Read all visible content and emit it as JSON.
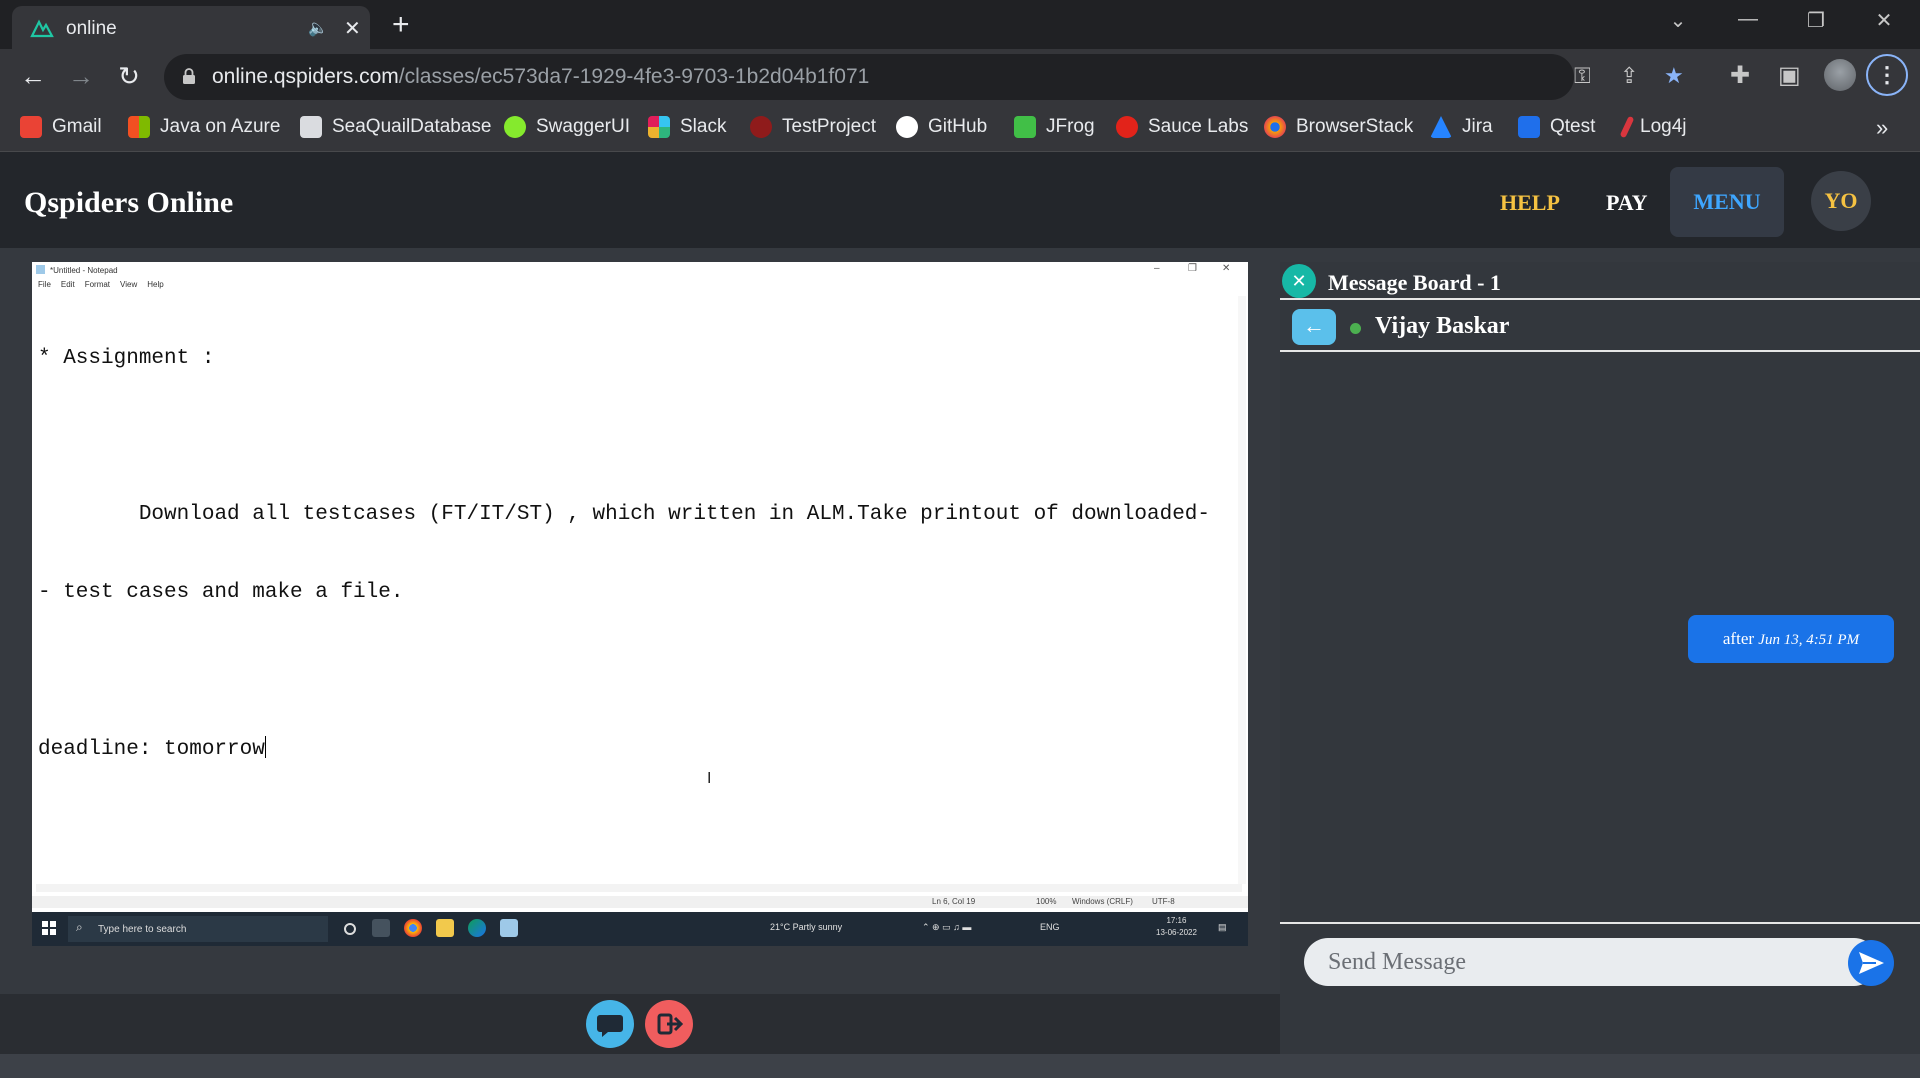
{
  "browser": {
    "tab_title": "online",
    "url_host": "online.qspiders.com",
    "url_path": "/classes/ec573da7-1929-4fe3-9703-1b2d04b1f071",
    "bookmarks": [
      {
        "label": "Gmail",
        "icon": "gmail-icon",
        "color": "#ea4335"
      },
      {
        "label": "Java on Azure",
        "icon": "microsoft-icon",
        "color": "#f25022"
      },
      {
        "label": "SeaQuailDatabase",
        "icon": "document-icon",
        "color": "#dadce0"
      },
      {
        "label": "SwaggerUI",
        "icon": "swagger-icon",
        "color": "#85ea2d"
      },
      {
        "label": "Slack",
        "icon": "slack-icon",
        "color": "#e01e5a"
      },
      {
        "label": "TestProject",
        "icon": "testproject-icon",
        "color": "#8f1b1b"
      },
      {
        "label": "GitHub",
        "icon": "github-icon",
        "color": "#ffffff"
      },
      {
        "label": "JFrog",
        "icon": "jfrog-icon",
        "color": "#41bf47"
      },
      {
        "label": "Sauce Labs",
        "icon": "saucelabs-icon",
        "color": "#e2231a"
      },
      {
        "label": "BrowserStack",
        "icon": "browserstack-icon",
        "color": "#f59e0b"
      },
      {
        "label": "Jira",
        "icon": "jira-icon",
        "color": "#2684ff"
      },
      {
        "label": "Qtest",
        "icon": "qtest-icon",
        "color": "#1f6feb"
      },
      {
        "label": "Log4j",
        "icon": "log4j-icon",
        "color": "#d9363e"
      }
    ]
  },
  "app": {
    "brand": "Qspiders Online",
    "help": "HELP",
    "pay": "PAY",
    "menu": "MENU",
    "avatar": "YO",
    "colors": {
      "help": "#f5c242",
      "pay": "#ffffff",
      "menu": "#3ea6ff",
      "accent": "#1a73e8"
    }
  },
  "notepad": {
    "title": "*Untitled - Notepad",
    "menu": [
      "File",
      "Edit",
      "Format",
      "View",
      "Help"
    ],
    "lines": [
      "* Assignment :",
      "",
      "        Download all testcases (FT/IT/ST) , which written in ALM.Take printout of downloaded-",
      "- test cases and make a file.",
      "",
      "deadline: tomorrow"
    ],
    "status": {
      "position": "Ln 6, Col 19",
      "zoom": "100%",
      "eol": "Windows (CRLF)",
      "encoding": "UTF-8"
    }
  },
  "taskbar": {
    "search_placeholder": "Type here to search",
    "weather": "21°C  Partly sunny",
    "lang": "ENG",
    "time": "17:16",
    "date": "13-06-2022"
  },
  "board": {
    "title": "Message Board - 1",
    "contact": "Vijay Baskar",
    "message_text": "after",
    "message_time": "Jun 13, 4:51 PM",
    "input_placeholder": "Send Message"
  }
}
